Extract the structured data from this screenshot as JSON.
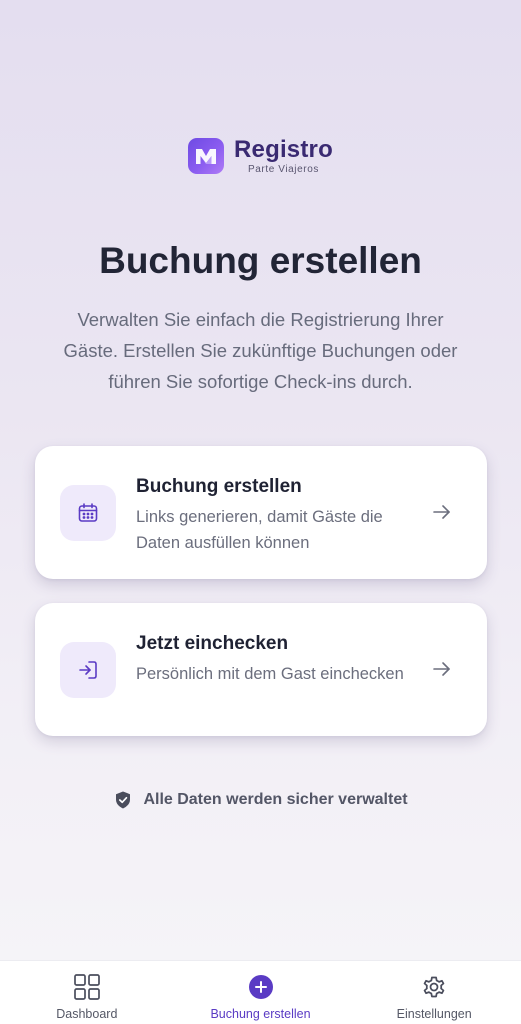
{
  "brand": {
    "name": "Registro",
    "tagline": "Parte Viajeros"
  },
  "page": {
    "title": "Buchung erstellen",
    "description": "Verwalten Sie einfach die Registrierung Ihrer Gäste. Erstellen Sie zukünftige Buchungen oder führen Sie sofortige Check-ins durch."
  },
  "cards": [
    {
      "icon": "calendar-icon",
      "title": "Buchung erstellen",
      "description": "Links generieren, damit Gäste die Daten ausfüllen können"
    },
    {
      "icon": "check-in-icon",
      "title": "Jetzt einchecken",
      "description": "Persönlich mit dem Gast einchecken"
    }
  ],
  "security_note": {
    "icon": "shield-check-icon",
    "text": "Alle Daten werden sicher verwaltet"
  },
  "bottom_nav": {
    "items": [
      {
        "label": "Dashboard",
        "icon": "grid-icon",
        "active": false
      },
      {
        "label": "Buchung erstellen",
        "icon": "plus-circle-icon",
        "active": true
      },
      {
        "label": "Einstellungen",
        "icon": "gear-icon",
        "active": false
      }
    ]
  },
  "colors": {
    "accent": "#5a3bc4",
    "brand_text": "#3a2a72",
    "card_icon_bg": "#efeafb"
  }
}
